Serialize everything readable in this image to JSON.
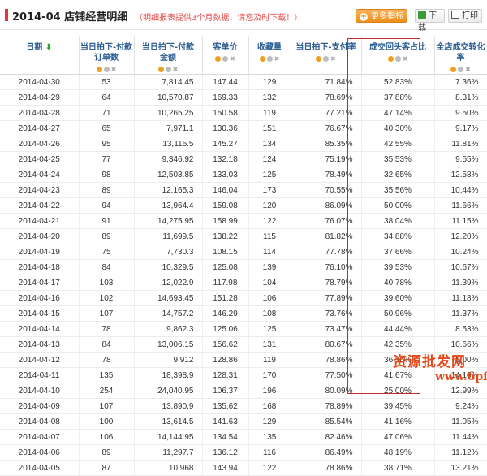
{
  "header": {
    "title": "2014-04 店铺经营明细",
    "note": "（明细报表提供3个月数据，请您及时下载！）",
    "more_metrics": "更多指标",
    "download": "下载",
    "print": "打印"
  },
  "columns": [
    {
      "l1": "日期",
      "l2": ""
    },
    {
      "l1": "当日拍下-付款",
      "l2": "订单数"
    },
    {
      "l1": "当日拍下-付款",
      "l2": "金额"
    },
    {
      "l1": "客单价",
      "l2": ""
    },
    {
      "l1": "收藏量",
      "l2": ""
    },
    {
      "l1": "当日拍下-支付率",
      "l2": ""
    },
    {
      "l1": "成交回头客占比",
      "l2": ""
    },
    {
      "l1": "全店成交转化率",
      "l2": ""
    }
  ],
  "rows": [
    [
      "2014-04-30",
      "53",
      "7,814.45",
      "147.44",
      "129",
      "71.84%",
      "52.83%",
      "7.36%"
    ],
    [
      "2014-04-29",
      "64",
      "10,570.87",
      "169.33",
      "132",
      "78.69%",
      "37.88%",
      "8.31%"
    ],
    [
      "2014-04-28",
      "71",
      "10,265.25",
      "150.58",
      "119",
      "77.21%",
      "47.14%",
      "9.50%"
    ],
    [
      "2014-04-27",
      "65",
      "7,971.1",
      "130.36",
      "151",
      "76.67%",
      "40.30%",
      "9.17%"
    ],
    [
      "2014-04-26",
      "95",
      "13,115.5",
      "145.27",
      "134",
      "85.35%",
      "42.55%",
      "11.81%"
    ],
    [
      "2014-04-25",
      "77",
      "9,346.92",
      "132.18",
      "124",
      "75.19%",
      "35.53%",
      "9.55%"
    ],
    [
      "2014-04-24",
      "98",
      "12,503.85",
      "133.03",
      "125",
      "78.49%",
      "32.65%",
      "12.58%"
    ],
    [
      "2014-04-23",
      "89",
      "12,165.3",
      "146.04",
      "173",
      "70.55%",
      "35.56%",
      "10.44%"
    ],
    [
      "2014-04-22",
      "94",
      "13,964.4",
      "159.08",
      "120",
      "86.09%",
      "50.00%",
      "11.66%"
    ],
    [
      "2014-04-21",
      "91",
      "14,275.95",
      "158.99",
      "122",
      "76.07%",
      "38.04%",
      "11.15%"
    ],
    [
      "2014-04-20",
      "89",
      "11,699.5",
      "138.22",
      "115",
      "81.82%",
      "34.88%",
      "12.20%"
    ],
    [
      "2014-04-19",
      "75",
      "7,730.3",
      "108.15",
      "114",
      "77.78%",
      "37.66%",
      "10.24%"
    ],
    [
      "2014-04-18",
      "84",
      "10,329.5",
      "125.08",
      "139",
      "76.10%",
      "39.53%",
      "10.67%"
    ],
    [
      "2014-04-17",
      "103",
      "12,022.9",
      "117.98",
      "104",
      "78.79%",
      "40.78%",
      "11.39%"
    ],
    [
      "2014-04-16",
      "102",
      "14,693.45",
      "151.28",
      "106",
      "77.89%",
      "39.60%",
      "11.18%"
    ],
    [
      "2014-04-15",
      "107",
      "14,757.2",
      "146.29",
      "108",
      "73.76%",
      "50.96%",
      "11.37%"
    ],
    [
      "2014-04-14",
      "78",
      "9,862.3",
      "125.06",
      "125",
      "73.47%",
      "44.44%",
      "8.53%"
    ],
    [
      "2014-04-13",
      "84",
      "13,006.15",
      "156.62",
      "131",
      "80.67%",
      "42.35%",
      "10.66%"
    ],
    [
      "2014-04-12",
      "78",
      "9,912",
      "128.86",
      "119",
      "78.86%",
      "36.36%",
      "9.00%"
    ],
    [
      "2014-04-11",
      "135",
      "18,398.9",
      "128.31",
      "170",
      "77.50%",
      "41.67%",
      "14.10%"
    ],
    [
      "2014-04-10",
      "254",
      "24,040.95",
      "106.37",
      "196",
      "80.09%",
      "25.00%",
      "12.99%"
    ],
    [
      "2014-04-09",
      "107",
      "13,890.9",
      "135.62",
      "168",
      "78.89%",
      "39.45%",
      "9.24%"
    ],
    [
      "2014-04-08",
      "100",
      "13,614.5",
      "141.63",
      "129",
      "85.54%",
      "41.16%",
      "11.05%"
    ],
    [
      "2014-04-07",
      "106",
      "14,144.95",
      "134.54",
      "135",
      "82.46%",
      "47.06%",
      "11.44%"
    ],
    [
      "2014-04-06",
      "89",
      "11,297.7",
      "136.12",
      "116",
      "86.49%",
      "48.19%",
      "11.12%"
    ],
    [
      "2014-04-05",
      "87",
      "10,968",
      "143.94",
      "122",
      "78.86%",
      "38.71%",
      "13.21%"
    ]
  ],
  "watermark": {
    "line1": "资源批发网",
    "line2": "www.6pf.cn"
  },
  "colors": {
    "accent_red": "#e3333c",
    "header_blue": "#2b5d93",
    "orange": "#ee8f1a"
  }
}
